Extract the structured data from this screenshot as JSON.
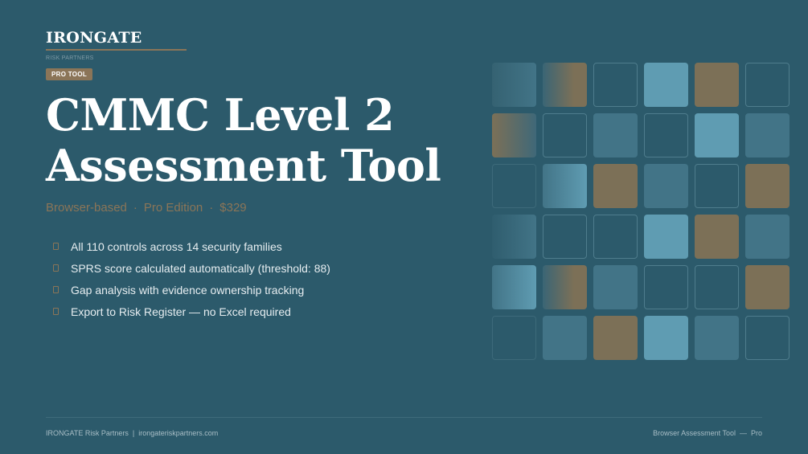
{
  "brand": {
    "name": "IRONGATE",
    "subtitle": "RISK PARTNERS"
  },
  "badge": "PRO TOOL",
  "title": {
    "line1": "CMMC Level 2",
    "line2": "Assessment Tool"
  },
  "subtitle": {
    "part1": "Browser-based",
    "part2": "Pro Edition",
    "part3": "$329",
    "separator": "·"
  },
  "features": [
    "All 110 controls across 14 security families",
    "SPRS score calculated automatically (threshold: 88)",
    "Gap analysis with evidence ownership tracking",
    "Export to Risk Register — no Excel required"
  ],
  "footer": {
    "left_company": "IRONGATE Risk Partners",
    "left_separator": "|",
    "left_url": "irongateriskpartners.com",
    "right_product": "Browser Assessment Tool",
    "right_separator": "—",
    "right_edition": "Pro"
  },
  "colors": {
    "background": "#2c5a6b",
    "accent_tan": "#8b7558",
    "tile_light_blue": "#5f9cb2",
    "tile_mid_blue": "#427487",
    "tile_tan": "#7c7057"
  }
}
